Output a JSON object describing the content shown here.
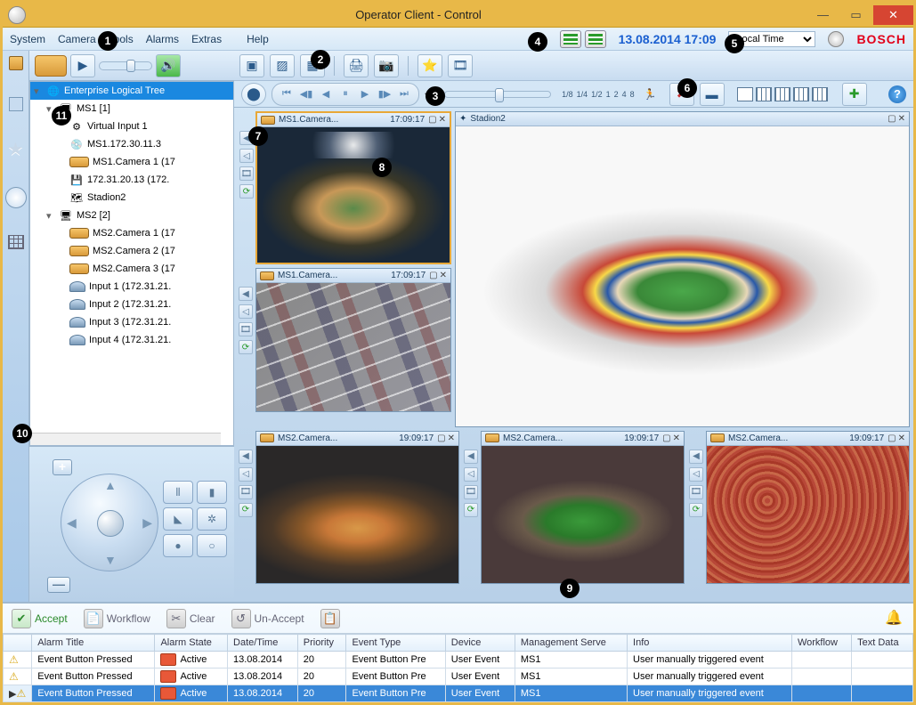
{
  "window": {
    "title": "Operator Client - Control"
  },
  "menu": {
    "system": "System",
    "camera": "Camera",
    "tools": "Tools",
    "alarms": "Alarms",
    "extras": "Extras",
    "help": "Help",
    "datetime": "13.08.2014 17:09",
    "timemode": "Local Time",
    "brand": "BOSCH"
  },
  "tree": {
    "root": "Enterprise Logical Tree",
    "ms1": {
      "label": "MS1 [1]",
      "items": [
        "Virtual Input 1",
        "MS1.172.30.11.3",
        "MS1.Camera 1 (17",
        "172.31.20.13 (172.",
        "Stadion2"
      ]
    },
    "ms2": {
      "label": "MS2 [2]",
      "items": [
        "MS2.Camera 1 (17",
        "MS2.Camera 2 (17",
        "MS2.Camera 3 (17",
        "Input 1 (172.31.21.",
        "Input 2 (172.31.21.",
        "Input 3 (172.31.21.",
        "Input 4 (172.31.21."
      ]
    }
  },
  "playback": {
    "speeds": [
      "1/8",
      "1/4",
      "1/2",
      "1",
      "2",
      "4",
      "8"
    ]
  },
  "panes": {
    "p1": {
      "title": "MS1.Camera...",
      "time": "17:09:17"
    },
    "p2": {
      "title": "Stadion2"
    },
    "p3": {
      "title": "MS1.Camera...",
      "time": "17:09:17"
    },
    "p4": {
      "title": "MS2.Camera...",
      "time": "19:09:17"
    },
    "p5": {
      "title": "MS2.Camera...",
      "time": "19:09:17"
    },
    "p6": {
      "title": "MS2.Camera...",
      "time": "19:09:17"
    }
  },
  "alarmToolbar": {
    "accept": "Accept",
    "workflow": "Workflow",
    "clear": "Clear",
    "unaccept": "Un-Accept"
  },
  "alarmHeaders": {
    "title": "Alarm Title",
    "state": "Alarm State",
    "dt": "Date/Time",
    "prio": "Priority",
    "etype": "Event Type",
    "device": "Device",
    "mserver": "Management Serve",
    "info": "Info",
    "workflow": "Workflow",
    "textdata": "Text Data"
  },
  "alarms": [
    {
      "title": "Event Button Pressed",
      "state": "Active",
      "dt": "13.08.2014",
      "prio": "20",
      "etype": "Event Button Pre",
      "device": "User Event",
      "ms": "MS1",
      "info": "User manually triggered event"
    },
    {
      "title": "Event Button Pressed",
      "state": "Active",
      "dt": "13.08.2014",
      "prio": "20",
      "etype": "Event Button Pre",
      "device": "User Event",
      "ms": "MS1",
      "info": "User manually triggered event"
    },
    {
      "title": "Event Button Pressed",
      "state": "Active",
      "dt": "13.08.2014",
      "prio": "20",
      "etype": "Event Button Pre",
      "device": "User Event",
      "ms": "MS1",
      "info": "User manually triggered event"
    }
  ],
  "markers": [
    "1",
    "2",
    "3",
    "4",
    "5",
    "6",
    "7",
    "8",
    "9",
    "10",
    "11"
  ]
}
